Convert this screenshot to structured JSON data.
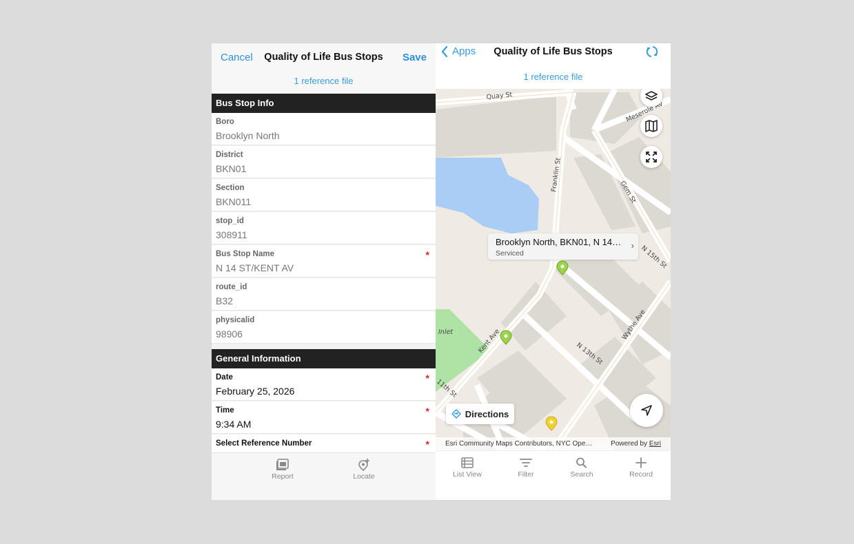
{
  "form": {
    "cancel_label": "Cancel",
    "title": "Quality of Life Bus Stops",
    "save_label": "Save",
    "reference_files": "1 reference file",
    "sections": [
      {
        "title": "Bus Stop Info",
        "fields": [
          {
            "label": "Boro",
            "value": "Brooklyn North",
            "required": false
          },
          {
            "label": "District",
            "value": "BKN01",
            "required": false
          },
          {
            "label": "Section",
            "value": "BKN011",
            "required": false
          },
          {
            "label": "stop_id",
            "value": "308911",
            "required": false
          },
          {
            "label": "Bus Stop Name",
            "value": "N 14 ST/KENT AV",
            "required": true
          },
          {
            "label": "route_id",
            "value": "B32",
            "required": false
          },
          {
            "label": "physicalid",
            "value": "98906",
            "required": false
          }
        ]
      },
      {
        "title": "General Information",
        "fields": [
          {
            "label": "Date",
            "value": "February 25, 2026",
            "required": true
          },
          {
            "label": "Time",
            "value": "9:34 AM",
            "required": true
          },
          {
            "label": "Select Reference Number",
            "value": "",
            "required": true
          }
        ]
      }
    ],
    "required_marker": "*",
    "toolbar": {
      "report_label": "Report",
      "locate_label": "Locate"
    }
  },
  "map_view": {
    "back_label": "Apps",
    "title": "Quality of Life Bus Stops",
    "reference_files": "1 reference file",
    "streets": [
      "Quay St",
      "Meserole Av",
      "Franklin St",
      "Gem St",
      "N 15th St",
      "Wythe Ave",
      "N 13th St",
      "Kent Ave",
      "11th St",
      "Inlet"
    ],
    "callout": {
      "title": "Brooklyn North, BKN01, N 14…",
      "subtitle": "Serviced",
      "chevron": "›"
    },
    "directions_label": "Directions",
    "attribution": "Esri Community Maps Contributors, NYC Ope…",
    "powered_by": "Powered by",
    "powered_by_link": "Esri",
    "marker_colors": {
      "serviced": "#9bd34a",
      "pending": "#f2d233"
    },
    "toolbar": {
      "list_view_label": "List View",
      "filter_label": "Filter",
      "search_label": "Search",
      "record_label": "Record"
    }
  },
  "colors": {
    "accent": "#2f8fd9",
    "section_bar": "#222222",
    "required": "#e02020",
    "water": "#a9cdf4",
    "park": "#aee3a5"
  }
}
